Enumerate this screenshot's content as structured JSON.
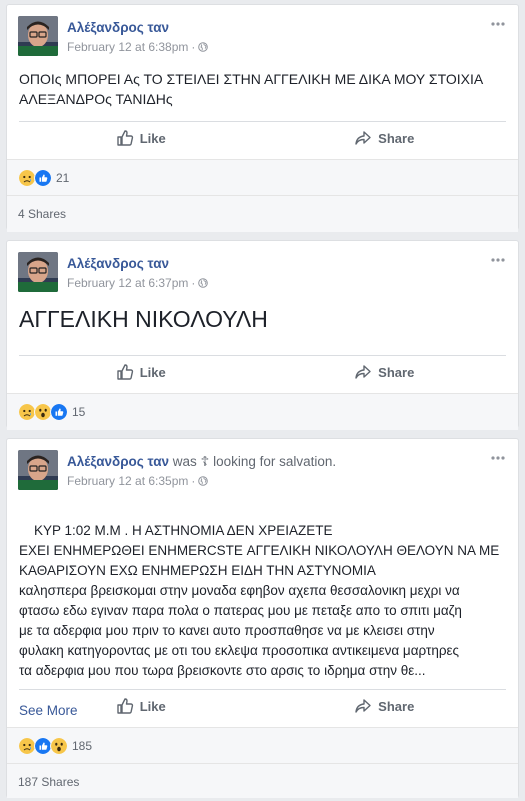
{
  "posts": [
    {
      "author": "Αλέξανδρος ταν",
      "status_extra": "",
      "timestamp": "February 12 at 6:38pm",
      "privacy_icon": "globe-icon",
      "text": "ΟΠΟΙς ΜΠΟΡΕΙ Ας ΤΟ ΣΤΕΙΛΕΙ ΣΤΗΝ ΑΓΓΕΛΙΚΗ ΜΕ ΔΙΚΑ ΜΟΥ ΣΤΟΙΧΙΑ\nΑΛΕΞΑΝΔΡΟς ΤΑΝΙΔΗς",
      "like_label": "Like",
      "share_label": "Share",
      "reaction_count": "21",
      "shares": "4 Shares"
    },
    {
      "author": "Αλέξανδρος ταν",
      "status_extra": "",
      "timestamp": "February 12 at 6:37pm",
      "privacy_icon": "globe-icon",
      "text": "ΑΓΓΕΛΙΚΗ ΝΙΚΟΛΟΥΛΗ",
      "like_label": "Like",
      "share_label": "Share",
      "reaction_count": "15",
      "shares": ""
    },
    {
      "author": "Αλέξανδρος ταν",
      "status_was": "was",
      "status_activity": "looking for salvation.",
      "activity_icon": "orthodox-cross-icon",
      "timestamp": "February 12 at 6:35pm",
      "privacy_icon": "globe-icon",
      "text": "ΚΥΡ 1:02 Μ.Μ . Η ΑΣΤΗΝΟΜΙΑ ΔΕΝ ΧΡΕΙΑΖΕΤΕ\nΕΧΕΙ ΕΝΗΜΕΡΩΘΕΙ ΕΝΗΜERCSTE ΑΓΓΕΛΙΚΗ ΝΙΚΟΛΟΥΛΗ ΘΕΛΟΥΝ ΝΑ ΜΕ\nΚΑΘΑΡΙΣΟΥΝ ΕΧΩ ΕΝΗΜΕΡΩΣΗ ΕΙΔΗ ΤΗΝ ΑΣΤΥΝΟΜΙΑ\nκαλησπερα βρεισκομαι στην μοναδα εφηβον αχεπα θεσσαλονικη μεχρι να\nφτασω εδω εγιναν παρα πολα ο πατερας μου με πεταξε απο το σπιτι μαζη\nμε τα αδερφια μου πριν το κανει αυτο προσπαθησε να με κλεισει στην\nφυλακη κατηγοροντας με οτι του εκλεψα προσοπικα αντικειμενα μαρτηρες\nτα αδερφια μου που τωρα βρεισκοντε στο αρσις το ιδρημα στην θε...",
      "see_more": "See More",
      "like_label": "Like",
      "share_label": "Share",
      "reaction_count": "185",
      "shares": "187 Shares"
    }
  ],
  "colors": {
    "link": "#385898",
    "like_blue": "#1877f2",
    "wow_yellow": "#f7c64a",
    "page_bg": "#e9ebee"
  }
}
